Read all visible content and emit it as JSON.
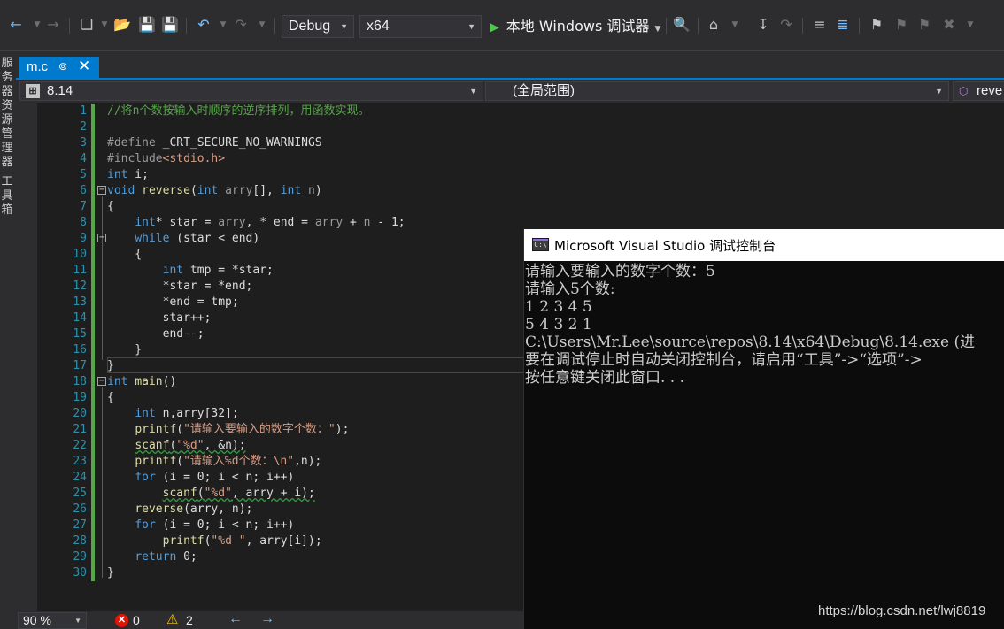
{
  "toolbar": {
    "configuration": "Debug",
    "platform": "x64",
    "run_label": "本地 Windows 调试器"
  },
  "side_tabs": {
    "server_explorer": "服务器资源管理器",
    "toolbox": "工具箱"
  },
  "document_tab": {
    "name": "m.c"
  },
  "navbar": {
    "project": "8.14",
    "scope": "(全局范围)",
    "member": "reve"
  },
  "editor": {
    "line_numbers": [
      "1",
      "2",
      "3",
      "4",
      "5",
      "6",
      "7",
      "8",
      "9",
      "10",
      "11",
      "12",
      "13",
      "14",
      "15",
      "16",
      "17",
      "18",
      "19",
      "20",
      "21",
      "22",
      "23",
      "24",
      "25",
      "26",
      "27",
      "28",
      "29",
      "30"
    ],
    "lines": [
      [
        {
          "t": "//将n个数按输入时顺序的逆序排列，用函数实现。",
          "c": "cm"
        }
      ],
      [],
      [
        {
          "t": "#define ",
          "c": "pp"
        },
        {
          "t": "_CRT_SECURE_NO_WARNINGS",
          "c": ""
        }
      ],
      [
        {
          "t": "#include",
          "c": "pp"
        },
        {
          "t": "<stdio.h>",
          "c": "st"
        }
      ],
      [
        {
          "t": "int",
          "c": "kw"
        },
        {
          "t": " i;",
          "c": ""
        }
      ],
      [
        {
          "t": "void",
          "c": "kw"
        },
        {
          "t": " ",
          "c": ""
        },
        {
          "t": "reverse",
          "c": "fn"
        },
        {
          "t": "(",
          "c": ""
        },
        {
          "t": "int",
          "c": "kw"
        },
        {
          "t": " ",
          "c": ""
        },
        {
          "t": "arry",
          "c": "pm"
        },
        {
          "t": "[], ",
          "c": ""
        },
        {
          "t": "int",
          "c": "kw"
        },
        {
          "t": " ",
          "c": ""
        },
        {
          "t": "n",
          "c": "pm"
        },
        {
          "t": ")",
          "c": ""
        }
      ],
      [
        {
          "t": "{",
          "c": ""
        }
      ],
      [
        {
          "t": "    ",
          "c": ""
        },
        {
          "t": "int",
          "c": "kw"
        },
        {
          "t": "* star = ",
          "c": ""
        },
        {
          "t": "arry",
          "c": "pm"
        },
        {
          "t": ", * end = ",
          "c": ""
        },
        {
          "t": "arry",
          "c": "pm"
        },
        {
          "t": " + ",
          "c": ""
        },
        {
          "t": "n",
          "c": "pm"
        },
        {
          "t": " - 1;",
          "c": ""
        }
      ],
      [
        {
          "t": "    ",
          "c": ""
        },
        {
          "t": "while",
          "c": "kw"
        },
        {
          "t": " (star < end)",
          "c": ""
        }
      ],
      [
        {
          "t": "    {",
          "c": ""
        }
      ],
      [
        {
          "t": "        ",
          "c": ""
        },
        {
          "t": "int",
          "c": "kw"
        },
        {
          "t": " tmp = *star;",
          "c": ""
        }
      ],
      [
        {
          "t": "        *star = *end;",
          "c": ""
        }
      ],
      [
        {
          "t": "        *end = tmp;",
          "c": ""
        }
      ],
      [
        {
          "t": "        star++;",
          "c": ""
        }
      ],
      [
        {
          "t": "        end--;",
          "c": ""
        }
      ],
      [
        {
          "t": "    }",
          "c": ""
        }
      ],
      [
        {
          "t": "}",
          "c": ""
        }
      ],
      [
        {
          "t": "int",
          "c": "kw"
        },
        {
          "t": " ",
          "c": ""
        },
        {
          "t": "main",
          "c": "fn"
        },
        {
          "t": "()",
          "c": ""
        }
      ],
      [
        {
          "t": "{",
          "c": ""
        }
      ],
      [
        {
          "t": "    ",
          "c": ""
        },
        {
          "t": "int",
          "c": "kw"
        },
        {
          "t": " n,arry[32];",
          "c": ""
        }
      ],
      [
        {
          "t": "    ",
          "c": ""
        },
        {
          "t": "printf",
          "c": "fn"
        },
        {
          "t": "(",
          "c": ""
        },
        {
          "t": "\"请输入要输入的数字个数：\"",
          "c": "st"
        },
        {
          "t": ");",
          "c": ""
        }
      ],
      [
        {
          "t": "    ",
          "c": ""
        },
        {
          "t": "scanf",
          "c": "fn sq"
        },
        {
          "t": "(",
          "c": "sq"
        },
        {
          "t": "\"%d\"",
          "c": "st sq"
        },
        {
          "t": ", &n);",
          "c": "sq"
        }
      ],
      [
        {
          "t": "    ",
          "c": ""
        },
        {
          "t": "printf",
          "c": "fn"
        },
        {
          "t": "(",
          "c": ""
        },
        {
          "t": "\"请输入%d个数：\\n\"",
          "c": "st"
        },
        {
          "t": ",n);",
          "c": ""
        }
      ],
      [
        {
          "t": "    ",
          "c": ""
        },
        {
          "t": "for",
          "c": "kw"
        },
        {
          "t": " (i = 0; i < n; i++)",
          "c": ""
        }
      ],
      [
        {
          "t": "        ",
          "c": ""
        },
        {
          "t": "scanf",
          "c": "fn sq"
        },
        {
          "t": "(",
          "c": "sq"
        },
        {
          "t": "\"%d\"",
          "c": "st sq"
        },
        {
          "t": ", arry + i);",
          "c": "sq"
        }
      ],
      [
        {
          "t": "    ",
          "c": ""
        },
        {
          "t": "reverse",
          "c": "fn"
        },
        {
          "t": "(arry, n);",
          "c": ""
        }
      ],
      [
        {
          "t": "    ",
          "c": ""
        },
        {
          "t": "for",
          "c": "kw"
        },
        {
          "t": " (i = 0; i < n; i++)",
          "c": ""
        }
      ],
      [
        {
          "t": "        ",
          "c": ""
        },
        {
          "t": "printf",
          "c": "fn"
        },
        {
          "t": "(",
          "c": ""
        },
        {
          "t": "\"%d \"",
          "c": "st"
        },
        {
          "t": ", arry[i]);",
          "c": ""
        }
      ],
      [
        {
          "t": "    ",
          "c": ""
        },
        {
          "t": "return",
          "c": "kw"
        },
        {
          "t": " 0;",
          "c": ""
        }
      ],
      [
        {
          "t": "}",
          "c": ""
        }
      ]
    ]
  },
  "status": {
    "zoom": "90 %",
    "errors": "0",
    "warnings": "2"
  },
  "console": {
    "title": "Microsoft Visual Studio 调试控制台",
    "lines": [
      "请输入要输入的数字个数：5",
      "请输入5个数:",
      "1 2 3 4 5",
      "5 4 3 2 1",
      "C:\\Users\\Mr.Lee\\source\\repos\\8.14\\x64\\Debug\\8.14.exe (进",
      "要在调试停止时自动关闭控制台，请启用“工具”->“选项”->",
      "按任意键关闭此窗口. . ."
    ]
  },
  "watermark": "https://blog.csdn.net/lwj8819"
}
